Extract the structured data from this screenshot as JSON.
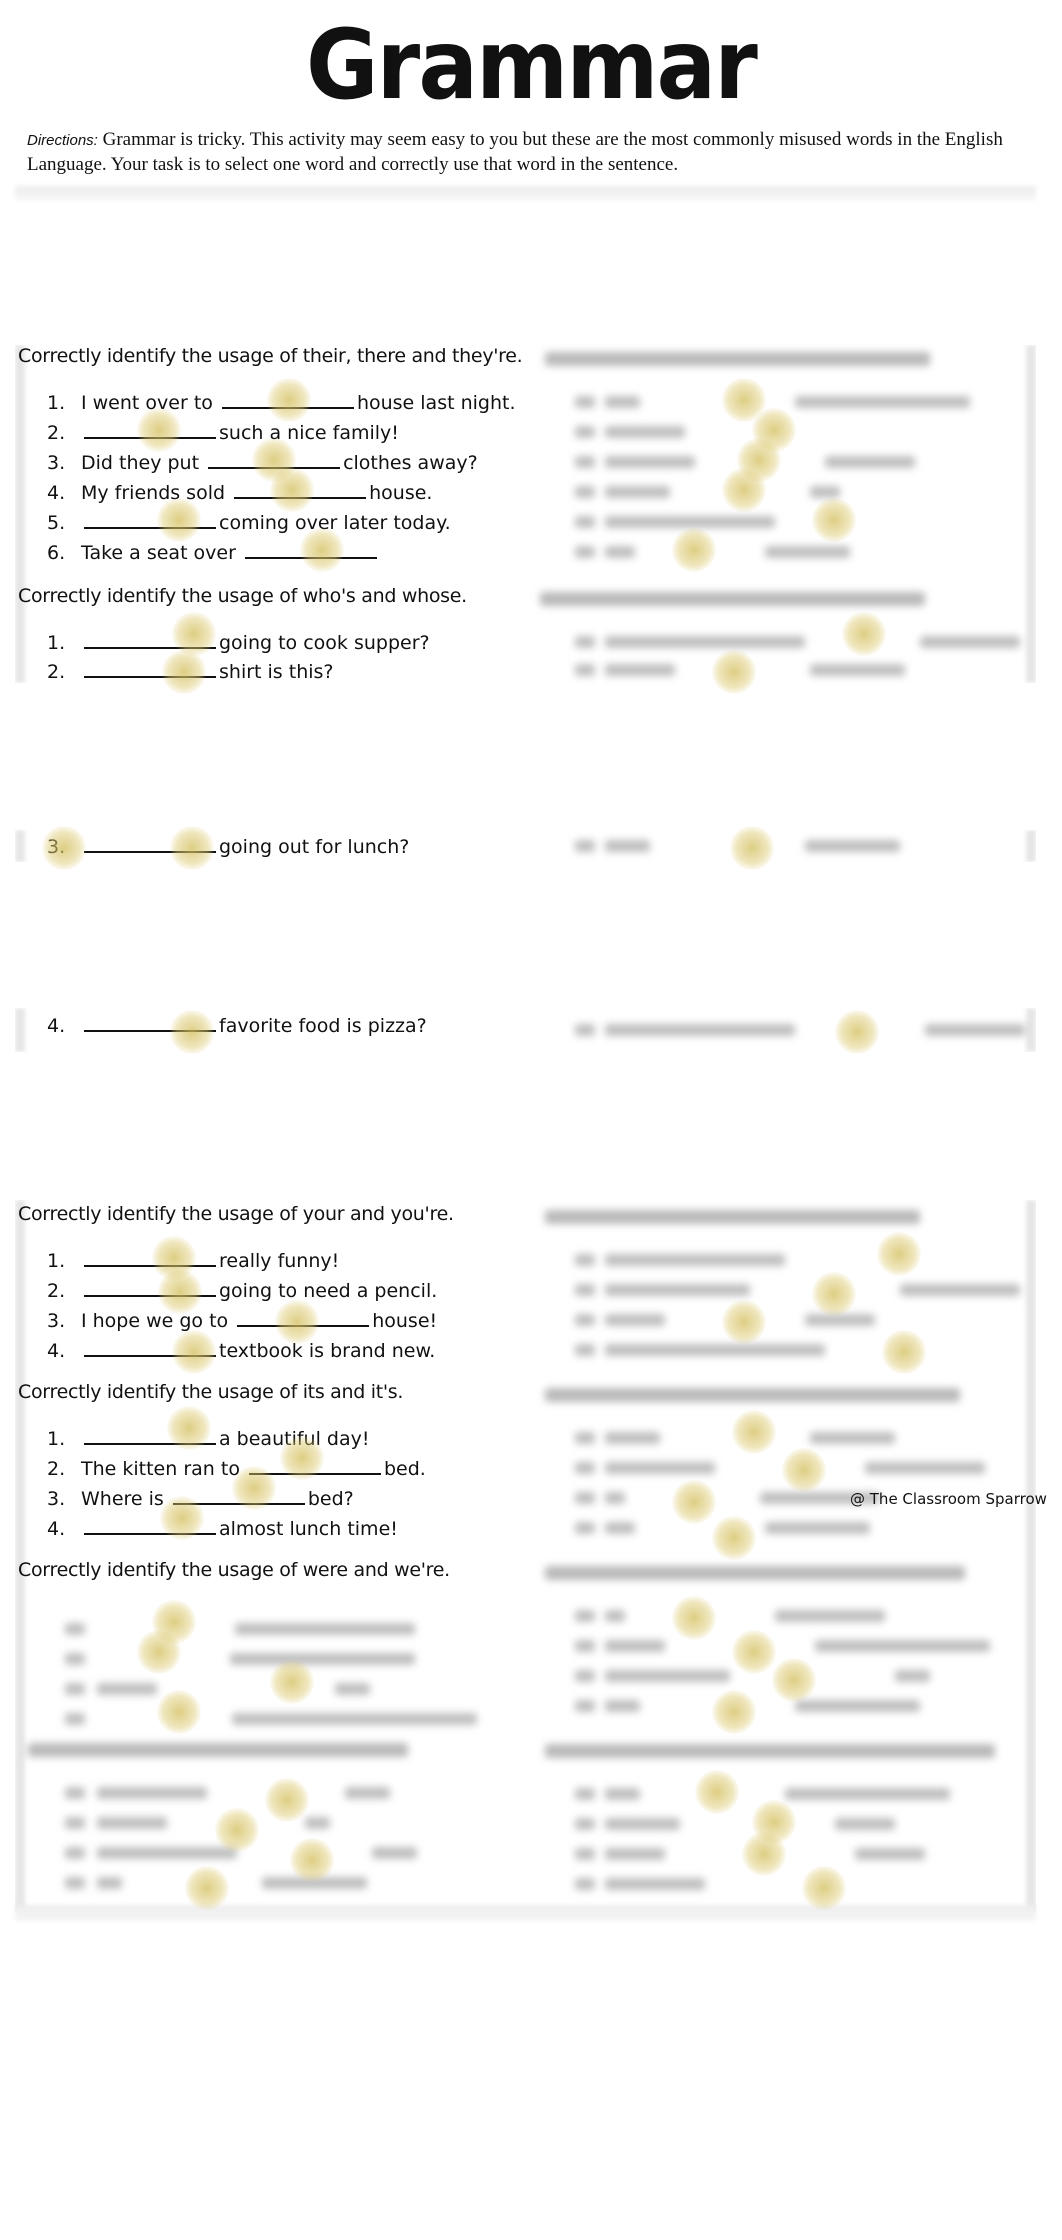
{
  "document": {
    "title": "Grammar",
    "directions_label": "Directions:",
    "directions_text": "Grammar is tricky. This activity may seem easy to you but these are the most commonly misused words in the English Language. Your task is to select one word and correctly use that word in the sentence.",
    "credit": "@ The Classroom Sparrow",
    "highlight_color": "#d9c56a"
  },
  "sections": [
    {
      "heading": "Correctly identify the usage of their, there and they're.",
      "questions": [
        {
          "num": "1.",
          "before": "I went over to",
          "after": "house last night."
        },
        {
          "num": "2.",
          "before": "",
          "after": "such a nice family!"
        },
        {
          "num": "3.",
          "before": "Did they put",
          "after": "clothes away?"
        },
        {
          "num": "4.",
          "before": "My friends sold",
          "after": "house."
        },
        {
          "num": "5.",
          "before": "",
          "after": "coming over later today."
        },
        {
          "num": "6.",
          "before": "Take a seat over",
          "after": ""
        }
      ]
    },
    {
      "heading": "Correctly identify the usage of who's and whose.",
      "questions": [
        {
          "num": "1.",
          "before": "",
          "after": "going to cook supper?"
        },
        {
          "num": "2.",
          "before": "",
          "after": "shirt is this?"
        },
        {
          "num": "3.",
          "before": "",
          "after": "going out for lunch?"
        },
        {
          "num": "4.",
          "before": "",
          "after": "favorite food is pizza?"
        }
      ]
    },
    {
      "heading": "Correctly identify the usage of your and you're.",
      "questions": [
        {
          "num": "1.",
          "before": "",
          "after": "really funny!"
        },
        {
          "num": "2.",
          "before": "",
          "after": "going to need a pencil."
        },
        {
          "num": "3.",
          "before": "I hope we go to",
          "after": "house!"
        },
        {
          "num": "4.",
          "before": "",
          "after": "textbook is brand new."
        }
      ]
    },
    {
      "heading": "Correctly identify the usage of its and it's.",
      "questions": [
        {
          "num": "1.",
          "before": "",
          "after": "a beautiful day!"
        },
        {
          "num": "2.",
          "before": "The kitten ran to",
          "after": "bed."
        },
        {
          "num": "3.",
          "before": "Where is",
          "after": "bed?"
        },
        {
          "num": "4.",
          "before": "",
          "after": "almost lunch time!"
        }
      ]
    },
    {
      "heading": "Correctly identify the usage of were and we're.",
      "questions": []
    }
  ]
}
